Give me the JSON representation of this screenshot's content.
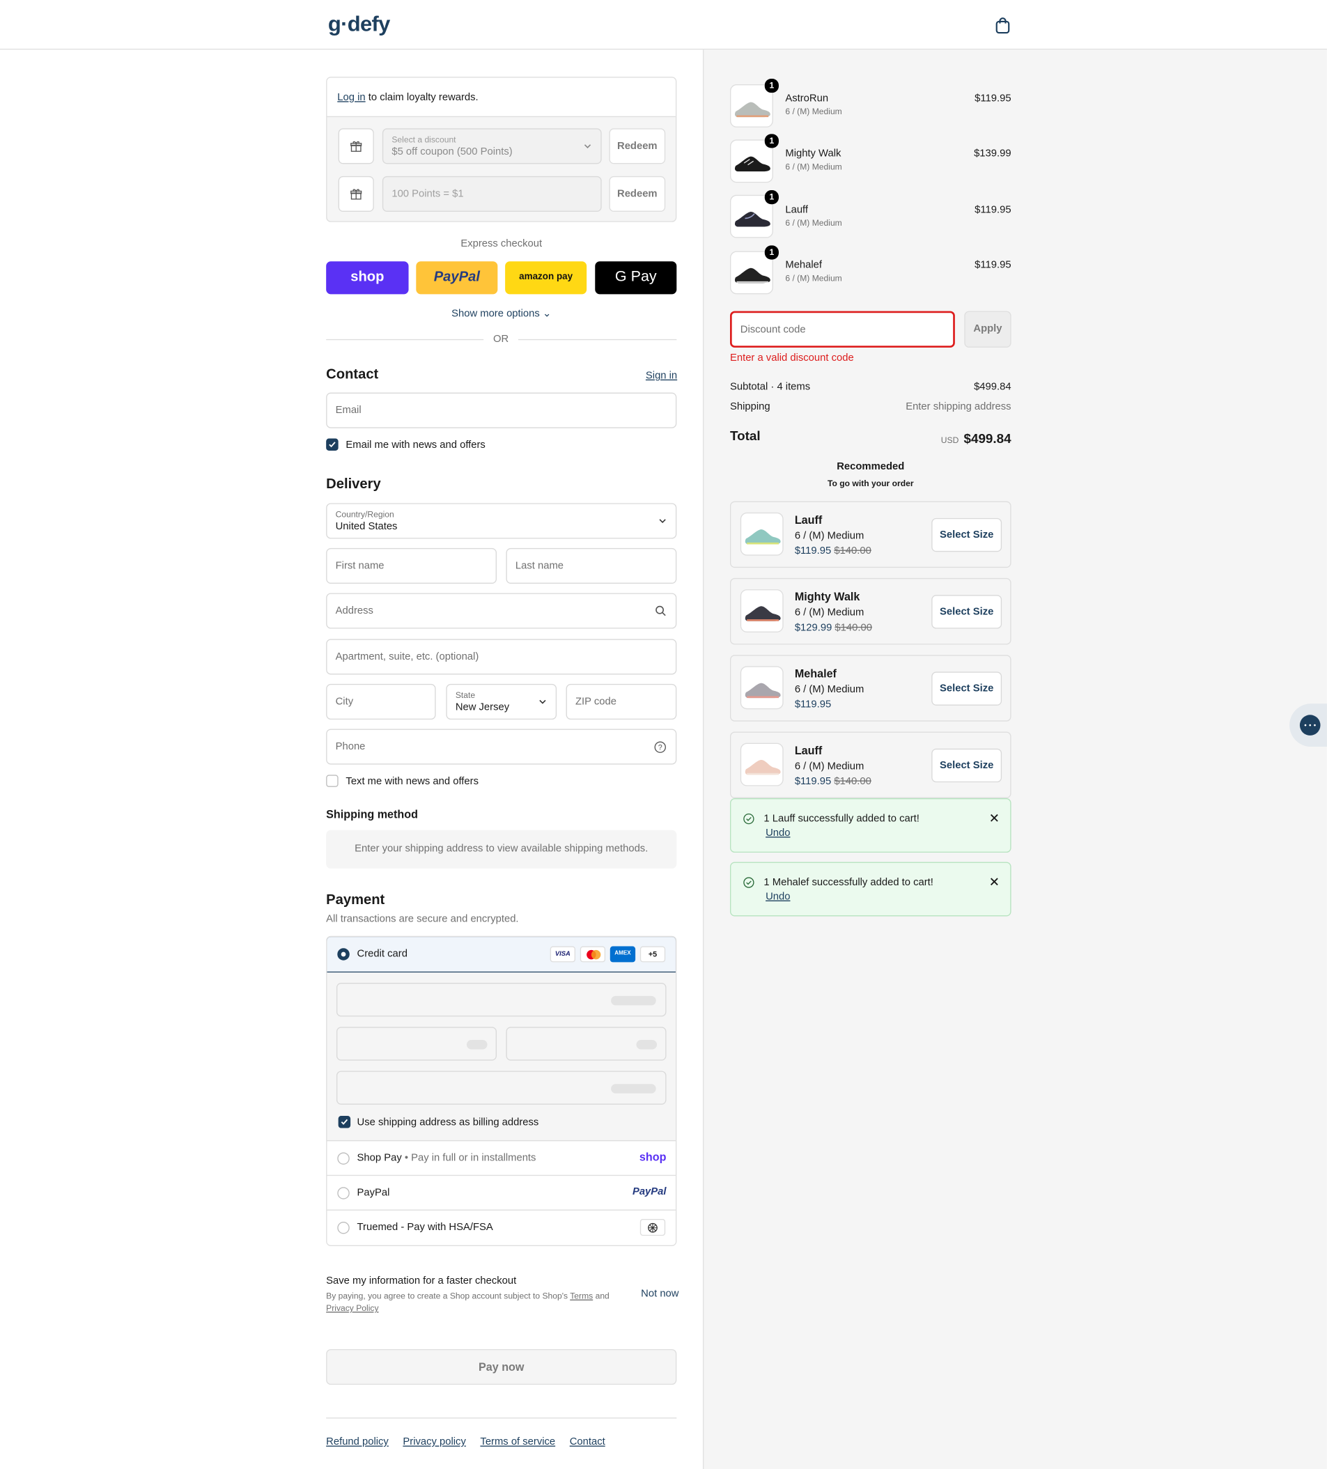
{
  "header": {
    "logo": "g·defy",
    "cart_icon": "shopping-bag-icon"
  },
  "loyalty": {
    "login_link": "Log in",
    "login_text": " to claim loyalty rewards.",
    "discount_select_label": "Select a discount",
    "discount_select_value": "$5 off coupon (500 Points)",
    "points_placeholder": "100 Points = $1",
    "redeem_label": "Redeem"
  },
  "express": {
    "title": "Express checkout",
    "buttons": [
      "shop",
      "PayPal",
      "amazon pay",
      "G Pay"
    ],
    "show_more": "Show more options",
    "or": "OR"
  },
  "contact": {
    "title": "Contact",
    "sign_in": "Sign in",
    "email_placeholder": "Email",
    "news_label": "Email me with news and offers",
    "news_checked": true
  },
  "delivery": {
    "title": "Delivery",
    "country_label": "Country/Region",
    "country_value": "United States",
    "first_name_ph": "First name",
    "last_name_ph": "Last name",
    "address_ph": "Address",
    "apartment_ph": "Apartment, suite, etc. (optional)",
    "city_ph": "City",
    "state_label": "State",
    "state_value": "New Jersey",
    "zip_ph": "ZIP code",
    "phone_ph": "Phone",
    "text_news_label": "Text me with news and offers",
    "text_news_checked": false
  },
  "shipping": {
    "title": "Shipping method",
    "notice": "Enter your shipping address to view available shipping methods."
  },
  "payment": {
    "title": "Payment",
    "subtitle": "All transactions are secure and encrypted.",
    "credit_card_label": "Credit card",
    "card_brands": [
      "VISA",
      "mastercard",
      "AMEX",
      "+5"
    ],
    "billing_label": "Use shipping address as billing address",
    "billing_checked": true,
    "shop_pay_label": "Shop Pay",
    "shop_pay_sub": "Pay in full or in installments",
    "shop_pay_logo": "shop",
    "paypal_label": "PayPal",
    "paypal_logo": "PayPal",
    "truemed_label": "Truemed - Pay with HSA/FSA"
  },
  "save_info": {
    "title": "Save my information for a faster checkout",
    "text_1": "By paying, you agree to create a Shop account subject to Shop's ",
    "terms": "Terms",
    "text_2": " and",
    "privacy": "Privacy Policy",
    "not_now": "Not now"
  },
  "pay_now": "Pay now",
  "footer_links": [
    "Refund policy",
    "Privacy policy",
    "Terms of service",
    "Contact"
  ],
  "cart": {
    "items": [
      {
        "name": "AstroRun",
        "variant": "6 / (M) Medium",
        "price": "$119.95",
        "qty": "1",
        "color": "#b9bdb9"
      },
      {
        "name": "Mighty Walk",
        "variant": "6 / (M) Medium",
        "price": "$139.99",
        "qty": "1",
        "color": "#1b1b1b"
      },
      {
        "name": "Lauff",
        "variant": "6 / (M) Medium",
        "price": "$119.95",
        "qty": "1",
        "color": "#2a2a35"
      },
      {
        "name": "Mehalef",
        "variant": "6 / (M) Medium",
        "price": "$119.95",
        "qty": "1",
        "color": "#222222"
      }
    ],
    "discount_placeholder": "Discount code",
    "apply_label": "Apply",
    "discount_error": "Enter a valid discount code",
    "subtotal_label": "Subtotal · 4 items",
    "subtotal_value": "$499.84",
    "shipping_label": "Shipping",
    "shipping_value": "Enter shipping address",
    "total_label": "Total",
    "currency": "USD",
    "total_value": "$499.84"
  },
  "recommended": {
    "title": "Recommeded",
    "subtitle": "To go with your order",
    "items": [
      {
        "name": "Lauff",
        "variant": "6 / (M) Medium",
        "price": "$119.95",
        "compare": "$140.00",
        "button": "Select Size",
        "color": "#8fc8c0"
      },
      {
        "name": "Mighty Walk",
        "variant": "6 / (M) Medium",
        "price": "$129.99",
        "compare": "$140.00",
        "button": "Select Size",
        "color": "#3a3a44"
      },
      {
        "name": "Mehalef",
        "variant": "6 / (M) Medium",
        "price": "$119.95",
        "compare": "",
        "button": "Select Size",
        "color": "#a9a6ad"
      },
      {
        "name": "Lauff",
        "variant": "6 / (M) Medium",
        "price": "$119.95",
        "compare": "$140.00",
        "button": "Select Size",
        "color": "#efcdbf"
      }
    ]
  },
  "toasts": [
    {
      "message": "1 Lauff successfully added to cart!",
      "undo": "Undo"
    },
    {
      "message": "1 Mehalef successfully added to cart!",
      "undo": "Undo"
    }
  ],
  "chat_icon": "chat-bubble-icon",
  "colors": {
    "brand": "#1d3f5e",
    "error": "#dd1d1d",
    "shop": "#5a31f4",
    "paypal": "#ffc439",
    "amazon": "#ffd814"
  }
}
